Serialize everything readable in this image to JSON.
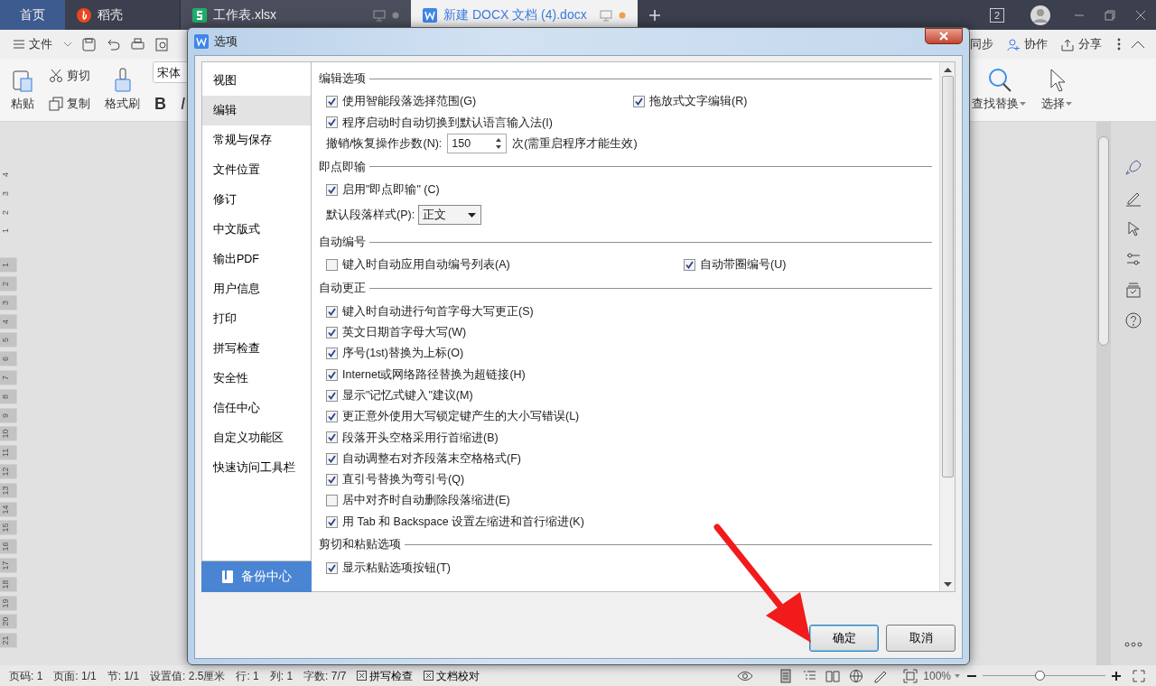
{
  "tabs": [
    {
      "label": "首页",
      "kind": "home",
      "selected": false
    },
    {
      "label": "稻壳",
      "kind": "docer",
      "selected": false
    },
    {
      "label": "工作表.xlsx",
      "kind": "sheet",
      "selected": false
    },
    {
      "label": "新建 DOCX 文档 (4).docx",
      "kind": "doc",
      "selected": true
    }
  ],
  "window_count": "2",
  "toolbar": {
    "file_menu": "文件",
    "right_items": [
      {
        "label": "同步",
        "kind": "sync"
      },
      {
        "label": "协作",
        "kind": "collab"
      },
      {
        "label": "分享",
        "kind": "share"
      }
    ]
  },
  "ribbon": {
    "paste": "粘贴",
    "cut": "剪切",
    "copy": "复制",
    "format_painter": "格式刷",
    "font": "宋体",
    "bold": "B",
    "italic": "I",
    "find_replace": "查找替换",
    "select": "选择"
  },
  "ruler": {
    "top_numbers": [
      "4",
      "3",
      "2",
      "1"
    ],
    "numbers": [
      "1",
      "2",
      "3",
      "4",
      "5",
      "6",
      "7",
      "8",
      "9",
      "10",
      "11",
      "12",
      "13",
      "14",
      "15",
      "16",
      "17",
      "18",
      "19",
      "20",
      "21"
    ]
  },
  "dialog": {
    "title": "选项",
    "sidebar": [
      {
        "label": "视图",
        "selected": false
      },
      {
        "label": "编辑",
        "selected": true
      },
      {
        "label": "常规与保存",
        "selected": false
      },
      {
        "label": "文件位置",
        "selected": false
      },
      {
        "label": "修订",
        "selected": false
      },
      {
        "label": "中文版式",
        "selected": false
      },
      {
        "label": "输出PDF",
        "selected": false
      },
      {
        "label": "用户信息",
        "selected": false
      },
      {
        "label": "打印",
        "selected": false
      },
      {
        "label": "拼写检查",
        "selected": false
      },
      {
        "label": "安全性",
        "selected": false
      },
      {
        "label": "信任中心",
        "selected": false
      },
      {
        "label": "自定义功能区",
        "selected": false
      },
      {
        "label": "快速访问工具栏",
        "selected": false
      }
    ],
    "backup_button": "备份中心",
    "sections": [
      {
        "title": "编辑选项",
        "rows": [
          {
            "kind": "checks",
            "items": [
              {
                "label": "使用智能段落选择范围(G)",
                "checked": true
              },
              {
                "label": "拖放式文字编辑(R)",
                "checked": true
              }
            ]
          },
          {
            "kind": "checks",
            "items": [
              {
                "label": "程序启动时自动切换到默认语言输入法(I)",
                "checked": true
              }
            ]
          },
          {
            "kind": "spinner",
            "label": "撤销/恢复操作步数(N):",
            "value": "150",
            "note": "次(需重启程序才能生效)"
          }
        ]
      },
      {
        "title": "即点即输",
        "rows": [
          {
            "kind": "checks",
            "items": [
              {
                "label": "启用\"即点即输\" (C)",
                "checked": true
              }
            ]
          },
          {
            "kind": "select",
            "label": "默认段落样式(P):",
            "value": "正文"
          }
        ]
      },
      {
        "title": "自动编号",
        "rows": [
          {
            "kind": "checks",
            "items": [
              {
                "label": "键入时自动应用自动编号列表(A)",
                "checked": false
              },
              {
                "label": "自动带圈编号(U)",
                "checked": true
              }
            ]
          }
        ]
      },
      {
        "title": "自动更正",
        "rows": [
          {
            "kind": "checks",
            "items": [
              {
                "label": "键入时自动进行句首字母大写更正(S)",
                "checked": true
              }
            ]
          },
          {
            "kind": "checks",
            "items": [
              {
                "label": "英文日期首字母大写(W)",
                "checked": true
              }
            ]
          },
          {
            "kind": "checks",
            "items": [
              {
                "label": "序号(1st)替换为上标(O)",
                "checked": true
              }
            ]
          },
          {
            "kind": "checks",
            "items": [
              {
                "label": "Internet或网络路径替换为超链接(H)",
                "checked": true
              }
            ]
          },
          {
            "kind": "checks",
            "items": [
              {
                "label": "显示\"记忆式键入\"建议(M)",
                "checked": true
              }
            ]
          },
          {
            "kind": "checks",
            "items": [
              {
                "label": "更正意外使用大写锁定键产生的大小写错误(L)",
                "checked": true
              }
            ]
          },
          {
            "kind": "checks",
            "items": [
              {
                "label": "段落开头空格采用行首缩进(B)",
                "checked": true
              }
            ]
          },
          {
            "kind": "checks",
            "items": [
              {
                "label": "自动调整右对齐段落末空格格式(F)",
                "checked": true
              }
            ]
          },
          {
            "kind": "checks",
            "items": [
              {
                "label": "直引号替换为弯引号(Q)",
                "checked": true
              }
            ]
          },
          {
            "kind": "checks",
            "items": [
              {
                "label": "居中对齐时自动删除段落缩进(E)",
                "checked": false
              }
            ]
          },
          {
            "kind": "checks",
            "items": [
              {
                "label": "用 Tab 和 Backspace 设置左缩进和首行缩进(K)",
                "checked": true
              }
            ]
          }
        ]
      },
      {
        "title": "剪切和粘贴选项",
        "rows": [
          {
            "kind": "checks",
            "items": [
              {
                "label": "显示粘贴选项按钮(T)",
                "checked": true
              }
            ]
          }
        ]
      }
    ],
    "buttons": [
      {
        "label": "确定",
        "kind": "primary"
      },
      {
        "label": "取消",
        "kind": "normal"
      }
    ]
  },
  "status_bar": {
    "items": [
      {
        "label": "页码: 1",
        "kind": "text"
      },
      {
        "label": "页面: 1/1",
        "kind": "text"
      },
      {
        "label": "节: 1/1",
        "kind": "text"
      },
      {
        "label": "设置值: 2.5厘米",
        "kind": "text"
      },
      {
        "label": "行: 1",
        "kind": "text"
      },
      {
        "label": "列: 1",
        "kind": "text"
      },
      {
        "label": "字数: 7/7",
        "kind": "text"
      },
      {
        "label": "拼写检查",
        "kind": "check"
      },
      {
        "label": "文档校对",
        "kind": "check"
      }
    ],
    "zoom": "100%",
    "zoom_slider": {
      "level": 0.46
    }
  }
}
